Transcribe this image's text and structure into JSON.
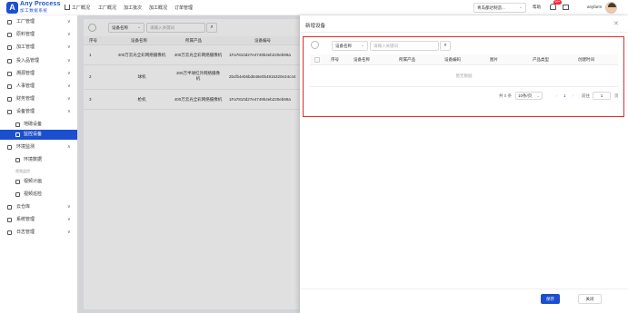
{
  "header": {
    "logo_title": "Any Process",
    "logo_sub": "加工数据系统",
    "nav": [
      "工厂概况",
      "工厂概况",
      "加工批次",
      "加工概况",
      "订单管理"
    ],
    "factory_select": "青岛都达制造...",
    "help": "帮助",
    "badge": "99+",
    "username": "anyfarm"
  },
  "sidebar": {
    "items": [
      {
        "label": "工厂管理",
        "arrow": "∨"
      },
      {
        "label": "原料管理",
        "arrow": "∨"
      },
      {
        "label": "加工管理",
        "arrow": "∨"
      },
      {
        "label": "投入品管理",
        "arrow": "∨"
      },
      {
        "label": "溯源管理",
        "arrow": "∨"
      },
      {
        "label": "人事管理",
        "arrow": "∨"
      },
      {
        "label": "财务管理",
        "arrow": "∨"
      },
      {
        "label": "设备管理",
        "arrow": "∧"
      },
      {
        "label": "地磅设备",
        "arrow": ""
      },
      {
        "label": "监控设备",
        "arrow": ""
      },
      {
        "label": "环境监测",
        "arrow": "∧"
      },
      {
        "label": "环境数据",
        "arrow": ""
      },
      {
        "label": "视频监控",
        "arrow": ""
      },
      {
        "label": "视频计画",
        "arrow": ""
      },
      {
        "label": "视频巡检",
        "arrow": ""
      },
      {
        "label": "云仓库",
        "arrow": "∨"
      },
      {
        "label": "系统管理",
        "arrow": "∨"
      },
      {
        "label": "日志管理",
        "arrow": "∨"
      }
    ]
  },
  "list": {
    "select": "设备名称",
    "search_placeholder": "请输入关键词",
    "columns": [
      "序号",
      "设备名称",
      "所属产品",
      "设备编号"
    ],
    "rows": [
      [
        "1",
        "400万云光全彩网络摄像机",
        "400万云光全彩网络摄像机",
        "1Fa7810d27e4749b4eb220eb98a"
      ],
      [
        "2",
        "球机",
        "300万半球红外网络摄像机",
        "2bcfb4eb6bd648e0b4915320e34c44"
      ],
      [
        "3",
        "枪机",
        "400万云光全彩网络摄像机",
        "1Fa7810d27e4749b4eb220eb98a"
      ]
    ]
  },
  "drawer": {
    "title": "新增设备",
    "select": "设备名称",
    "search_placeholder": "请输入关键词",
    "columns": [
      "序号",
      "设备名称",
      "所属产品",
      "设备编码",
      "图片",
      "产品类型",
      "创建时间"
    ],
    "empty": "暂无数据",
    "total": "共 0 条",
    "page_size": "10条/页",
    "page": "1",
    "goto_label": "前往",
    "goto_value": "1",
    "page_unit": "页",
    "save": "保存",
    "close": "关闭"
  }
}
